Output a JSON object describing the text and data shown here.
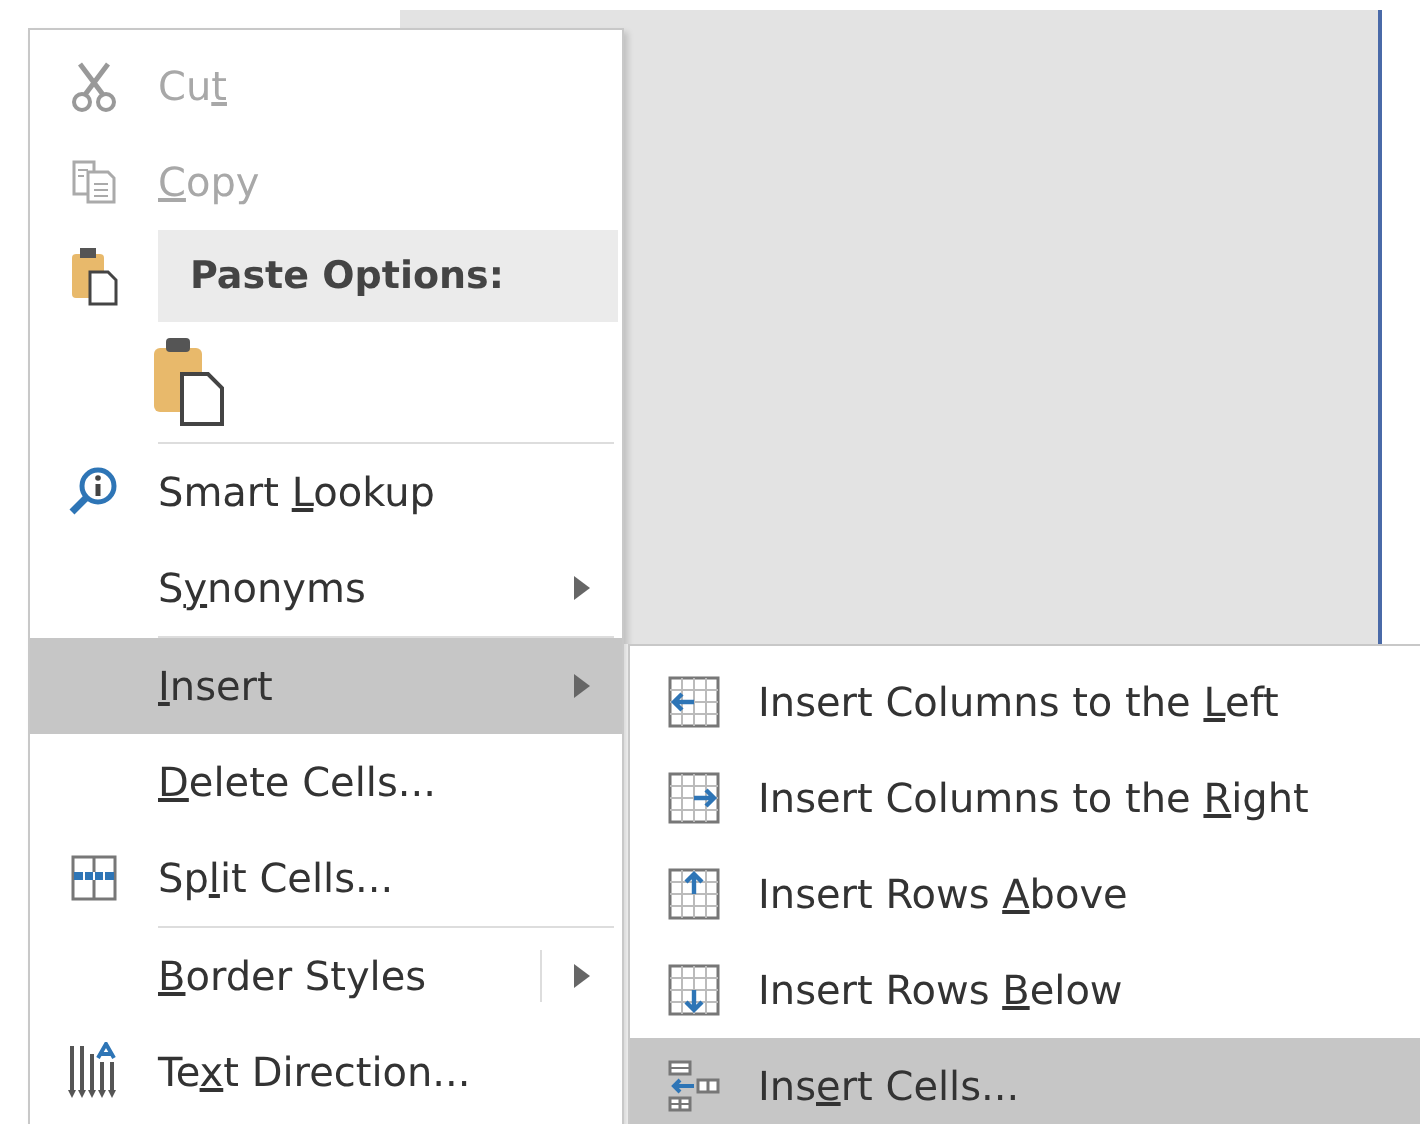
{
  "context_menu": {
    "items": [
      {
        "kind": "item",
        "label": "Cut",
        "disabled": true,
        "selected": false
      },
      {
        "kind": "item",
        "label": "Copy",
        "disabled": true,
        "selected": false
      },
      {
        "kind": "header",
        "label": "Paste Options:"
      },
      {
        "kind": "paste"
      },
      {
        "kind": "item",
        "label": "Smart Lookup",
        "disabled": false,
        "selected": false,
        "separator_before": true
      },
      {
        "kind": "submenu",
        "label": "Synonyms",
        "disabled": false,
        "selected": false
      },
      {
        "kind": "submenu",
        "label": "Insert",
        "disabled": false,
        "selected": true,
        "separator_before": true
      },
      {
        "kind": "item",
        "label": "Delete Cells...",
        "disabled": false,
        "selected": false
      },
      {
        "kind": "item",
        "label": "Split Cells...",
        "disabled": false,
        "selected": false
      },
      {
        "kind": "split_submenu",
        "label": "Border Styles",
        "disabled": false,
        "selected": false,
        "separator_before": true
      },
      {
        "kind": "item",
        "label": "Text Direction...",
        "disabled": false,
        "selected": false
      }
    ]
  },
  "insert_submenu": {
    "items": [
      {
        "label": "Insert Columns to the Left",
        "selected": false
      },
      {
        "label": "Insert Columns to the Right",
        "selected": false
      },
      {
        "label": "Insert Rows Above",
        "selected": false
      },
      {
        "label": "Insert Rows Below",
        "selected": false
      },
      {
        "label": "Insert Cells...",
        "selected": true
      }
    ]
  }
}
